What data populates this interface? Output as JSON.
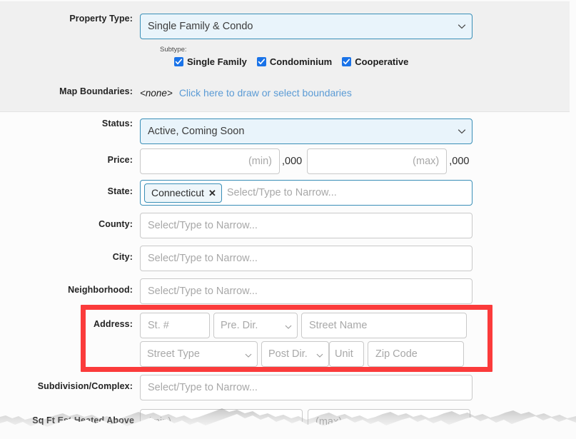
{
  "form": {
    "property_type": {
      "label": "Property Type:",
      "value": "Single Family & Condo",
      "chevron_icon": "chevron-down-icon"
    },
    "subtype": {
      "caption": "Subtype:",
      "options": [
        {
          "label": "Single Family",
          "checked": true
        },
        {
          "label": "Condominium",
          "checked": true
        },
        {
          "label": "Cooperative",
          "checked": true
        }
      ]
    },
    "map_boundaries": {
      "label": "Map Boundaries:",
      "value": "<none>",
      "link": "Click here to draw or select boundaries"
    },
    "status": {
      "label": "Status:",
      "value": "Active, Coming Soon",
      "chevron_icon": "chevron-down-icon"
    },
    "price": {
      "label": "Price:",
      "min_placeholder": "(min)",
      "min_value": "",
      "min_suffix": ",000",
      "max_placeholder": "(max)",
      "max_value": "",
      "max_suffix": ",000"
    },
    "state": {
      "label": "State:",
      "chips": [
        {
          "label": "Connecticut",
          "remove_icon": "close-icon"
        }
      ],
      "placeholder": "Select/Type to Narrow..."
    },
    "county": {
      "label": "County:",
      "placeholder": "Select/Type to Narrow...",
      "value": ""
    },
    "city": {
      "label": "City:",
      "placeholder": "Select/Type to Narrow...",
      "value": ""
    },
    "neighborhood": {
      "label": "Neighborhood:",
      "placeholder": "Select/Type to Narrow...",
      "value": ""
    },
    "address": {
      "label": "Address:",
      "street_number": {
        "placeholder": "St. #",
        "value": ""
      },
      "pre_dir": {
        "placeholder": "Pre. Dir.",
        "value": ""
      },
      "street_name": {
        "placeholder": "Street Name",
        "value": ""
      },
      "street_type": {
        "placeholder": "Street Type",
        "value": ""
      },
      "post_dir": {
        "placeholder": "Post Dir.",
        "value": ""
      },
      "unit": {
        "placeholder": "Unit",
        "value": ""
      },
      "zip_code": {
        "placeholder": "Zip Code",
        "value": ""
      },
      "highlight_color": "#fb3b3b"
    },
    "subdivision": {
      "label": "Subdivision/Complex:",
      "placeholder": "Select/Type to Narrow...",
      "value": ""
    },
    "sqft": {
      "label": "Sq Ft Est Heated Above",
      "min_placeholder": "(min)",
      "max_placeholder": "(max)"
    }
  },
  "theme": {
    "accent_border": "#3a8fb7",
    "select_bg": "#e9f4fb",
    "checkbox_blue": "#1a73e8",
    "link_blue": "#5b9bd5",
    "highlight_red": "#fb3b3b",
    "panel_gray": "#f0f0f0"
  }
}
